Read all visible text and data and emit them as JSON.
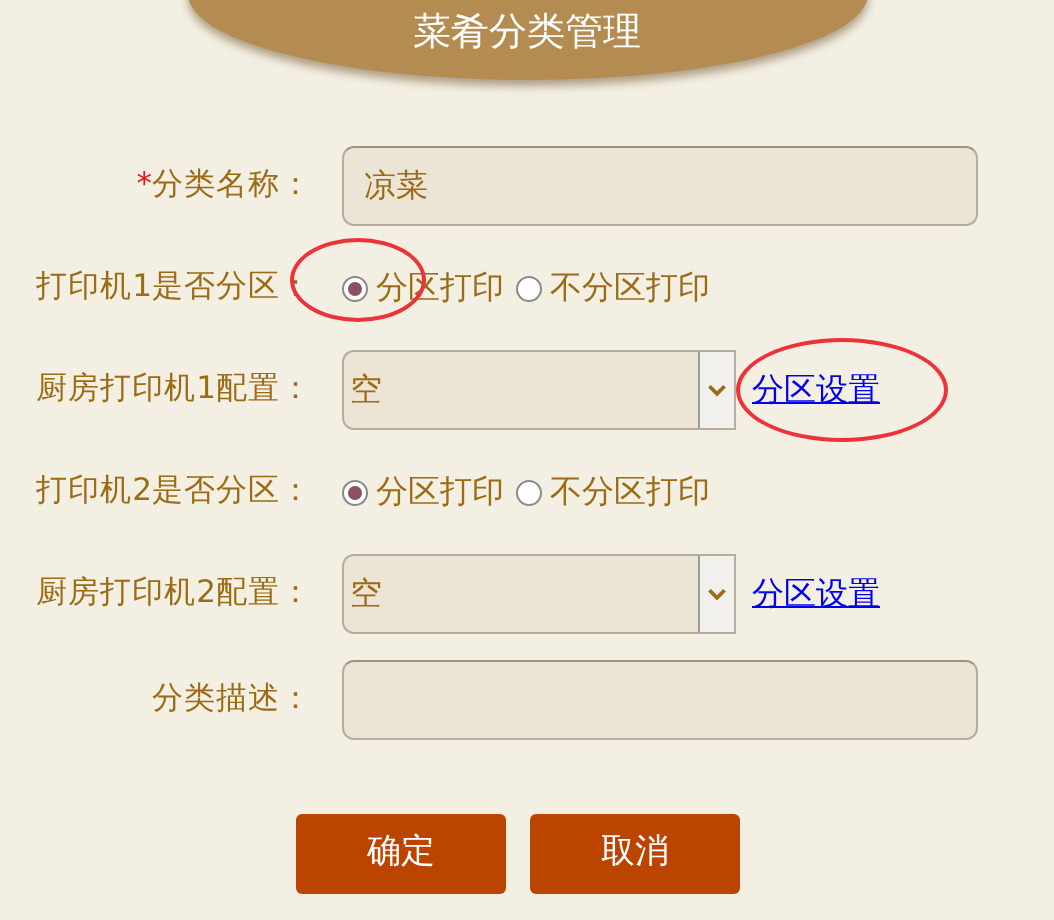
{
  "title": "菜肴分类管理",
  "fields": [
    {
      "kind": "text",
      "required_mark": "*",
      "label": "分类名称：",
      "value": "凉菜"
    },
    {
      "kind": "radio",
      "label": "打印机1是否分区：",
      "options": [
        {
          "label": "分区打印",
          "selected": true,
          "circled": true
        },
        {
          "label": "不分区打印",
          "selected": false,
          "circled": false
        }
      ]
    },
    {
      "kind": "select",
      "label": "厨房打印机1配置：",
      "value": "空",
      "link": {
        "text": "分区设置",
        "circled": true
      }
    },
    {
      "kind": "radio",
      "label": "打印机2是否分区：",
      "options": [
        {
          "label": "分区打印",
          "selected": true,
          "circled": false
        },
        {
          "label": "不分区打印",
          "selected": false,
          "circled": false
        }
      ]
    },
    {
      "kind": "select",
      "label": "厨房打印机2配置：",
      "value": "空",
      "link": {
        "text": "分区设置",
        "circled": false
      }
    },
    {
      "kind": "text",
      "label": "分类描述："
    }
  ],
  "buttons": [
    "确定",
    "取消"
  ]
}
